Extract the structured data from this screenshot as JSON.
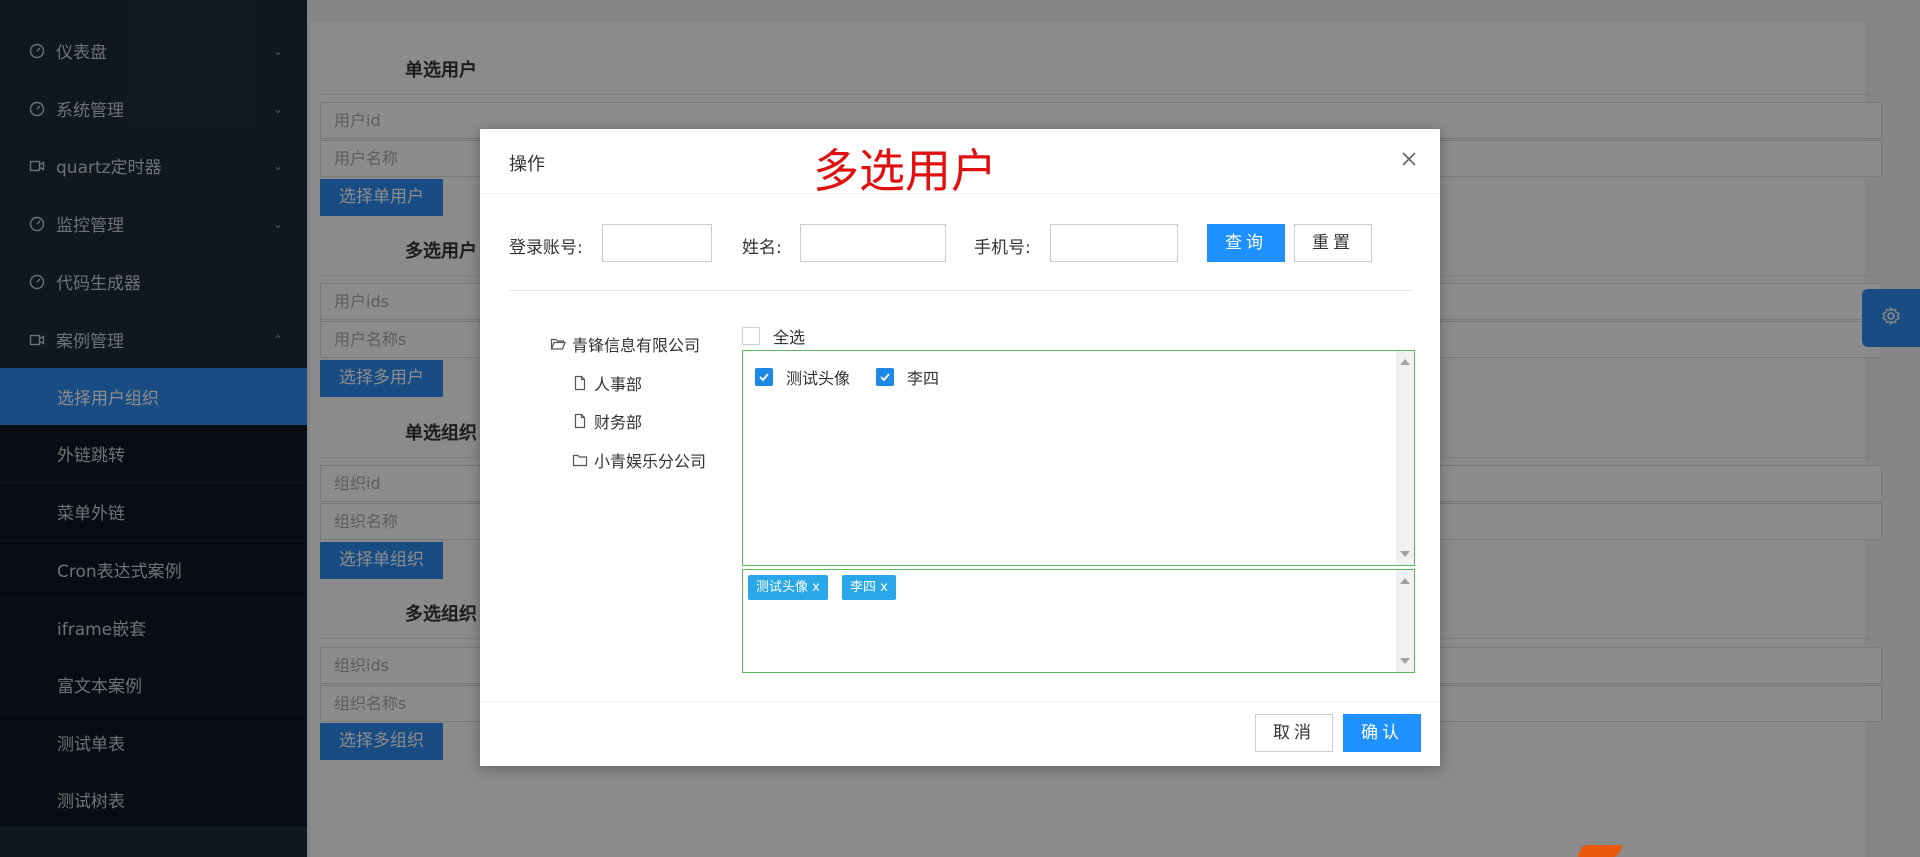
{
  "sidebar": {
    "items": [
      {
        "label": "仪表盘",
        "icon": "dashboard-icon"
      },
      {
        "label": "系统管理",
        "icon": "dashboard-icon"
      },
      {
        "label": "quartz定时器",
        "icon": "video-icon"
      },
      {
        "label": "监控管理",
        "icon": "dashboard-icon"
      },
      {
        "label": "代码生成器",
        "icon": "dashboard-icon"
      },
      {
        "label": "案例管理",
        "icon": "video-icon"
      }
    ],
    "sub_items": [
      {
        "label": "选择用户组织"
      },
      {
        "label": "外链跳转"
      },
      {
        "label": "菜单外链"
      },
      {
        "label": "Cron表达式案例"
      },
      {
        "label": "iframe嵌套"
      },
      {
        "label": "富文本案例"
      },
      {
        "label": "测试单表"
      },
      {
        "label": "测试树表"
      }
    ],
    "active_sub_index": 0
  },
  "page": {
    "sections": [
      {
        "title": "单选用户",
        "fields": [
          "用户id",
          "用户名称"
        ],
        "button": "选择单用户"
      },
      {
        "title": "多选用户",
        "fields": [
          "用户ids",
          "用户名称s"
        ],
        "button": "选择多用户"
      },
      {
        "title": "单选组织",
        "fields": [
          "组织id",
          "组织名称"
        ],
        "button": "选择单组织"
      },
      {
        "title": "多选组织",
        "fields": [
          "组织ids",
          "组织名称s"
        ],
        "button": "选择多组织"
      }
    ]
  },
  "modal": {
    "title": "操作",
    "annotation": "多选用户",
    "query": {
      "account_label": "登录账号:",
      "name_label": "姓名:",
      "phone_label": "手机号:",
      "account_value": "",
      "name_value": "",
      "phone_value": "",
      "search_label": "查询",
      "reset_label": "重置"
    },
    "tree": {
      "root": "青锋信息有限公司",
      "children": [
        "人事部",
        "财务部",
        "小青娱乐分公司"
      ]
    },
    "select_all_label": "全选",
    "users": [
      {
        "name": "测试头像",
        "checked": true
      },
      {
        "name": "李四",
        "checked": true
      }
    ],
    "selected_tags": [
      "测试头像 x",
      "李四 x"
    ],
    "cancel_label": "取消",
    "confirm_label": "确认"
  },
  "colors": {
    "primary": "#1e90ff",
    "sidebar_bg": "#1d2b3a",
    "annotation": "#e01010",
    "list_border": "#5cb85c",
    "tag_bg": "#2aa7e8"
  }
}
